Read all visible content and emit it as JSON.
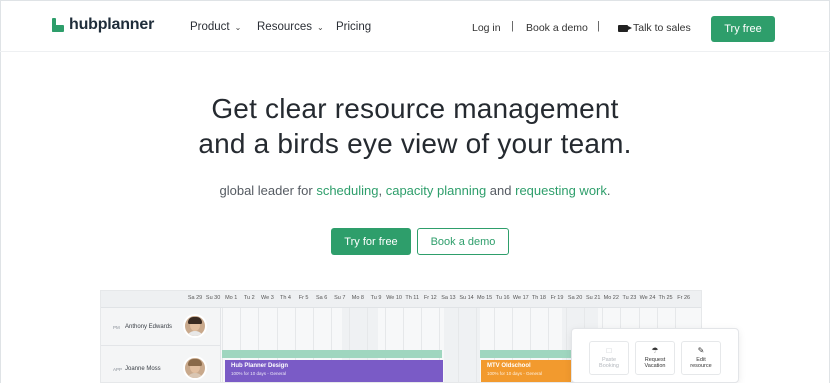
{
  "brand": {
    "name": "hubplanner",
    "color": "#2e9e6b"
  },
  "nav": {
    "items": [
      {
        "label": "Product",
        "dropdown": true
      },
      {
        "label": "Resources",
        "dropdown": true
      },
      {
        "label": "Pricing",
        "dropdown": false
      }
    ],
    "login": "Log in",
    "separator": "|",
    "book_demo": "Book a demo",
    "talk_sales": "Talk to sales",
    "talk_sales_icon": "video-camera-icon",
    "try_free": "Try free"
  },
  "hero": {
    "title_line1": "Get clear resource management",
    "title_line2": "and a birds eye view of your team.",
    "subtitle": {
      "prefix": "global leader for ",
      "link1": "scheduling",
      "comma": ", ",
      "link2": "capacity planning",
      "and": " and ",
      "link3": "requesting work",
      "suffix": "."
    },
    "primary_cta": "Try for free",
    "secondary_cta": "Book a demo"
  },
  "scheduler": {
    "days": [
      "Sa 29",
      "Su 30",
      "Mo 1",
      "Tu 2",
      "We 3",
      "Th 4",
      "Fr 5",
      "Sa 6",
      "Su 7",
      "Mo 8",
      "Tu 9",
      "We 10",
      "Th 11",
      "Fr 12",
      "Sa 13",
      "Su 14",
      "Mo 15",
      "Tu 16",
      "We 17",
      "Th 18",
      "Fr 19",
      "Sa 20",
      "Su 21",
      "Mo 22",
      "Tu 23",
      "We 24",
      "Th 25",
      "Fr 26"
    ],
    "resources": [
      {
        "tag": "PM",
        "name": "Anthony Edwards"
      },
      {
        "tag": "APP",
        "name": "Joanne Moss"
      }
    ],
    "bookings": [
      {
        "title": "Hub Planner Design",
        "detail": "100% for 10 days - General",
        "color": "#7a5bc6"
      },
      {
        "title": "MTV Oldschool",
        "detail": "100% for 10 days - General",
        "color": "#f29a2e"
      }
    ],
    "popup": {
      "actions": [
        {
          "label_line1": "Paste",
          "label_line2": "Booking",
          "icon": "clipboard-icon",
          "enabled": false
        },
        {
          "label_line1": "Request",
          "label_line2": "Vacation",
          "icon": "umbrella-icon",
          "enabled": true
        },
        {
          "label_line1": "Edit",
          "label_line2": "resource",
          "icon": "pencil-icon",
          "enabled": true
        }
      ]
    }
  }
}
